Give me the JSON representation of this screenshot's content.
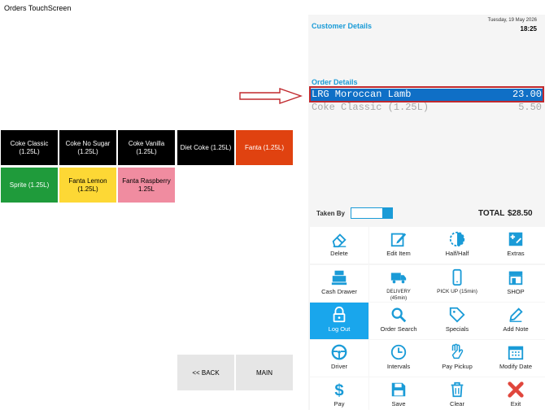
{
  "window": {
    "title": "Orders TouchScreen"
  },
  "products": [
    {
      "label": "Coke Classic (1.25L)",
      "bg": "#000000",
      "fg": "#ffffff"
    },
    {
      "label": "Coke No Sugar (1.25L)",
      "bg": "#000000",
      "fg": "#ffffff"
    },
    {
      "label": "Coke Vanilla (1.25L)",
      "bg": "#000000",
      "fg": "#ffffff"
    },
    {
      "label": "Diet Coke (1.25L)",
      "bg": "#000000",
      "fg": "#ffffff"
    },
    {
      "label": "Fanta (1.25L)",
      "bg": "#e04210",
      "fg": "#ffffff"
    },
    {
      "label": "Sprite (1.25L)",
      "bg": "#1f9b3b",
      "fg": "#ffffff"
    },
    {
      "label": "Fanta Lemon (1.25L)",
      "bg": "#fdd835",
      "fg": "#000000"
    },
    {
      "label": "Fanta Raspberry 1.25L",
      "bg": "#f08ca0",
      "fg": "#000000"
    }
  ],
  "nav": {
    "back": "<< BACK",
    "main": "MAIN"
  },
  "header": {
    "date": "Tuesday, 19 May 2026",
    "time": "18:25"
  },
  "customer": {
    "title": "Customer Details"
  },
  "order": {
    "title": "Order Details",
    "items": [
      {
        "name": "LRG Moroccan Lamb",
        "price": "23.00",
        "selected": true
      },
      {
        "name": "Coke Classic (1.25L)",
        "price": "5.50",
        "selected": false
      }
    ]
  },
  "taken_by": {
    "label": "Taken By",
    "value": ""
  },
  "total": {
    "label": "TOTAL",
    "value": "$28.50"
  },
  "functions": [
    {
      "label": "Delete",
      "icon": "eraser"
    },
    {
      "label": "Edit Item",
      "icon": "edit"
    },
    {
      "label": "Half/Half",
      "icon": "half"
    },
    {
      "label": "Extras",
      "icon": "extras"
    },
    {
      "label": "Cash Drawer",
      "icon": "register"
    },
    {
      "label": "DELIVERY\n(45min)",
      "icon": "truck"
    },
    {
      "label": "PICK UP (15min)",
      "icon": "phone"
    },
    {
      "label": "SHOP",
      "icon": "shop"
    },
    {
      "label": "Log Out",
      "icon": "lock"
    },
    {
      "label": "Order Search",
      "icon": "search"
    },
    {
      "label": "Specials",
      "icon": "tag"
    },
    {
      "label": "Add Note",
      "icon": "pencil"
    },
    {
      "label": "Driver",
      "icon": "wheel"
    },
    {
      "label": "Intervals",
      "icon": "clock"
    },
    {
      "label": "Pay Pickup",
      "icon": "hand"
    },
    {
      "label": "Modify Date",
      "icon": "calendar"
    },
    {
      "label": "Pay",
      "icon": "dollar"
    },
    {
      "label": "Save",
      "icon": "save"
    },
    {
      "label": "Clear",
      "icon": "trash"
    },
    {
      "label": "Exit",
      "icon": "x"
    }
  ],
  "colors": {
    "accent": "#1a9bd7",
    "active": "#19a6ec",
    "selected": "#0f6fc6",
    "annotation": "#c0282d"
  }
}
